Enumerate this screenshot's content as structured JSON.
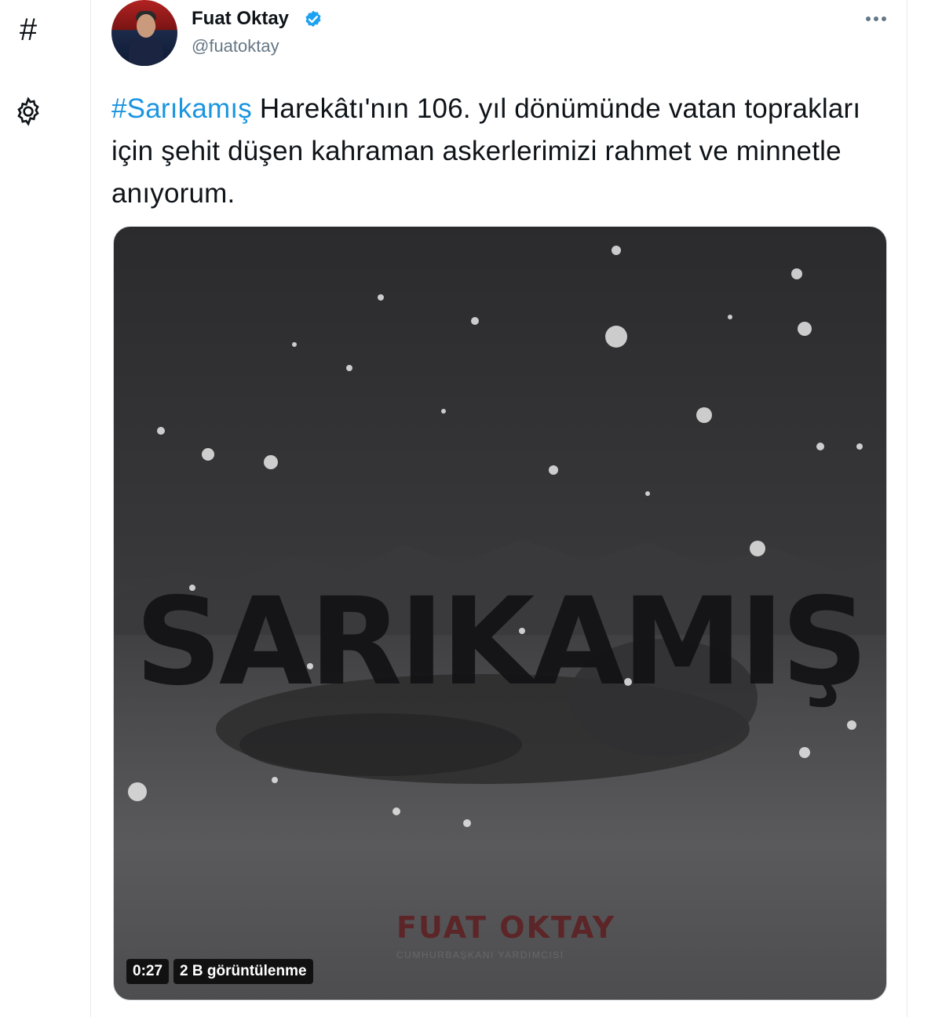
{
  "left_rail": {
    "items": [
      {
        "icon": "hashtag-icon",
        "glyph": "#"
      },
      {
        "icon": "gear-icon"
      }
    ]
  },
  "tweet": {
    "author": {
      "name": "Fuat Oktay",
      "handle": "@fuatoktay",
      "verified": true
    },
    "text_parts": {
      "hashtag": "#Sarıkamış",
      "body": " Harekâtı'nın 106. yıl dönümünde vatan toprakları için şehit düşen kahraman askerlerimizi rahmet ve minnetle anıyorum."
    },
    "media": {
      "poster_title": "SARIKAMIŞ",
      "brand_logo": "FUAT OKTAY",
      "brand_subtitle": "CUMHURBAŞKANI YARDIMCISI",
      "video_duration": "0:27",
      "views": "2 B görüntülenme"
    }
  },
  "colors": {
    "accent": "#1b95e0",
    "text": "#0f1419",
    "secondary": "#657786",
    "verified": "#1da1f2"
  }
}
